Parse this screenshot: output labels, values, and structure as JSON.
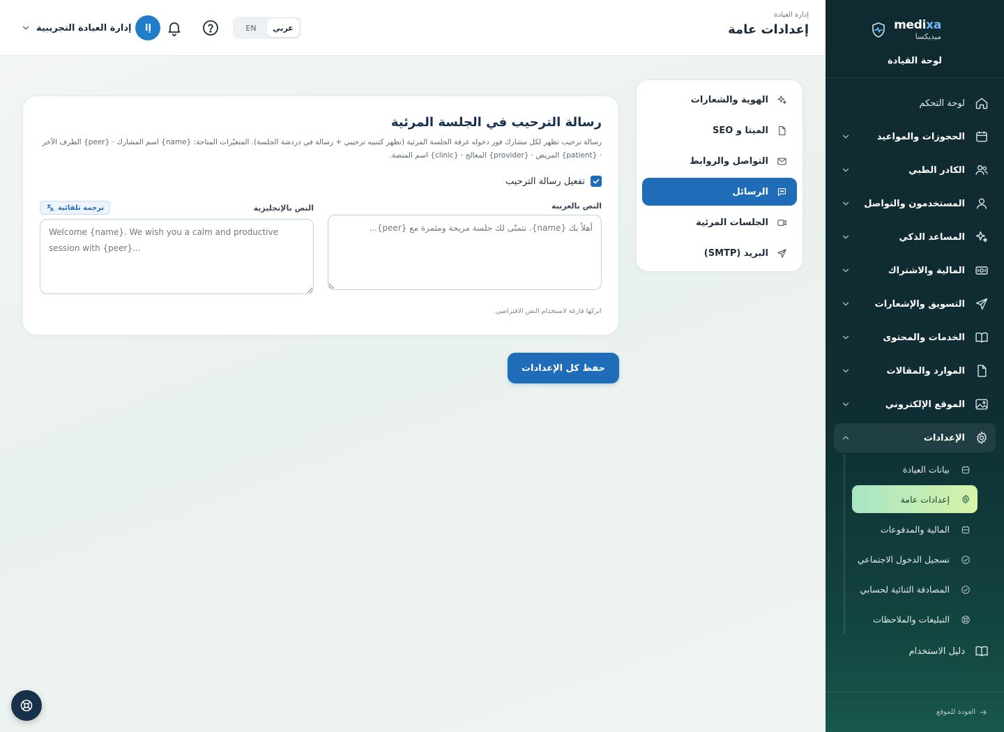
{
  "brand": {
    "name_main": "medi",
    "name_accent": "xa",
    "name_ar": "ميديكسا",
    "subtitle": "لوحة القيادة"
  },
  "header": {
    "breadcrumb": "إدارة العيادة",
    "title": "إعدادات عامة",
    "lang_ar": "عربي",
    "lang_en": "EN",
    "user_name": "إدارة العيادة التجريبية",
    "user_initials": "إا"
  },
  "sidebar": {
    "items": [
      {
        "label": "لوحة التحكم",
        "icon": "home-icon"
      },
      {
        "label": "الحجوزات والمواعيد",
        "icon": "calendar-icon"
      },
      {
        "label": "الكادر الطبي",
        "icon": "users-icon"
      },
      {
        "label": "المستخدمون والتواصل",
        "icon": "user-icon"
      },
      {
        "label": "المساعد الذكي",
        "icon": "sparkles-icon"
      },
      {
        "label": "المالية والاشتراك",
        "icon": "money-icon"
      },
      {
        "label": "التسويق والإشعارات",
        "icon": "send-icon"
      },
      {
        "label": "الخدمات والمحتوى",
        "icon": "book-icon"
      },
      {
        "label": "الموارد والمقالات",
        "icon": "file-icon"
      },
      {
        "label": "الموقع الإلكتروني",
        "icon": "image-icon"
      },
      {
        "label": "الإعدادات",
        "icon": "gear-icon"
      }
    ],
    "sub_items": [
      {
        "label": "بيانات العيادة"
      },
      {
        "label": "إعدادات عامة"
      },
      {
        "label": "المالية والمدفوعات"
      },
      {
        "label": "تسجيل الدخول الاجتماعي"
      },
      {
        "label": "المصادقة الثنائية لحسابي"
      },
      {
        "label": "التبليغات والملاحظات"
      }
    ],
    "guide": "دليل الاستخدام",
    "back": "العودة للموقع"
  },
  "tabs": [
    {
      "label": "الهوية والشعارات"
    },
    {
      "label": "الميتا و SEO"
    },
    {
      "label": "التواصل والروابط"
    },
    {
      "label": "الرسائل"
    },
    {
      "label": "الجلسات المرئية"
    },
    {
      "label": "البريد (SMTP)"
    }
  ],
  "welcome": {
    "title": "رسالة الترحيب في الجلسة المرئية",
    "description": "رسالة ترحيب تظهر لكل مشارك فور دخوله غرفة الجلسة المرئية (تظهر كتنبيه ترحيبي + رسالة في دردشة الجلسة). المتغيّرات المتاحة: {name} اسم المشارك · {peer} الطرف الآخر · {patient} المريض · {provider} المعالج · {clinic} اسم المنصة.",
    "enable_label": "تفعيل رسالة الترحيب",
    "enabled": true,
    "ar_label": "النص بالعربية",
    "ar_placeholder": "أهلاً بك {name}. نتمنّى لك جلسة مريحة ومثمرة مع {peer}...",
    "en_label": "النص بالإنجليزية",
    "en_placeholder": "Welcome {name}. We wish you a calm and productive session with {peer}...",
    "auto_translate": "ترجمة تلقائية",
    "hint": "اتركها فارغة لاستخدام النص الافتراضي."
  },
  "save_button": "حفظ كل الإعدادات",
  "colors": {
    "primary": "#1f6cb8",
    "sidebar": "#102a32",
    "active_sub": "#a8e6c5"
  }
}
